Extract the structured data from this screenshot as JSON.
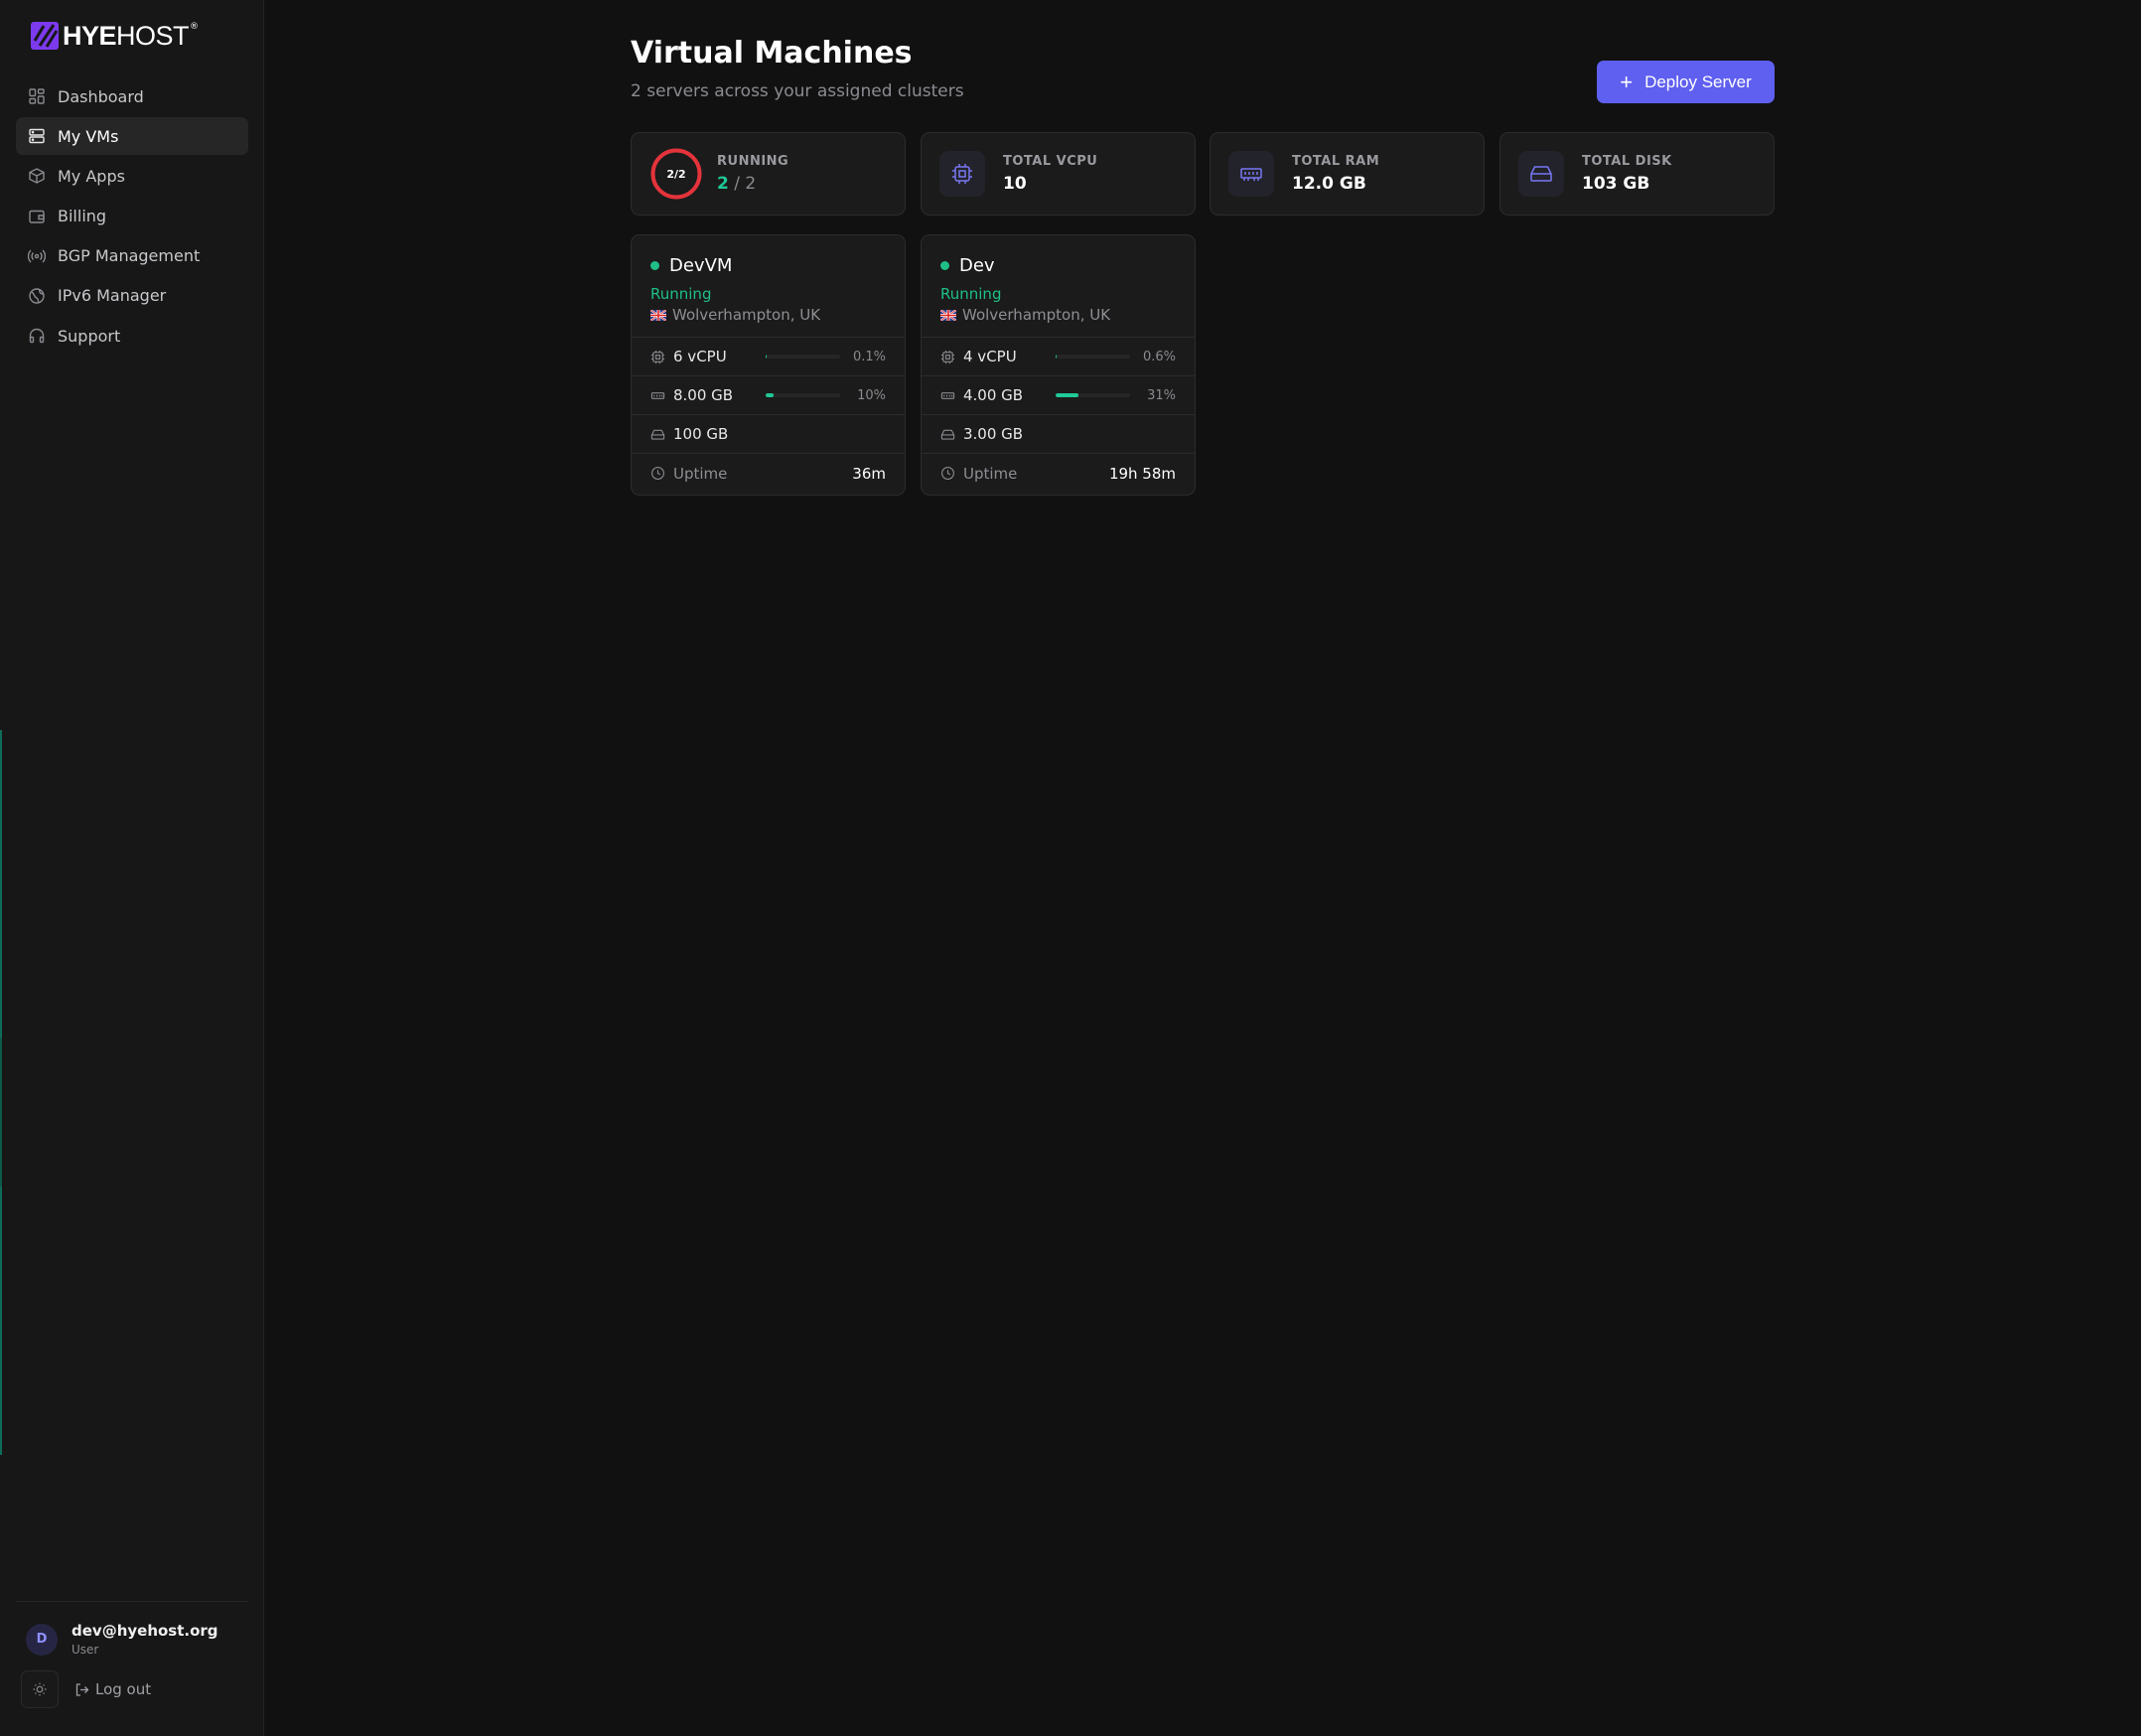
{
  "brand": {
    "name_bold": "HYE",
    "name_thin": "HOST",
    "reg": "®",
    "accent": "#7c3aed"
  },
  "nav": [
    {
      "label": "Dashboard",
      "icon": "grid-icon",
      "active": false
    },
    {
      "label": "My VMs",
      "icon": "server-icon",
      "active": true
    },
    {
      "label": "My Apps",
      "icon": "package-icon",
      "active": false
    },
    {
      "label": "Billing",
      "icon": "wallet-icon",
      "active": false
    },
    {
      "label": "BGP Management",
      "icon": "radio-icon",
      "active": false
    },
    {
      "label": "IPv6 Manager",
      "icon": "globe-icon",
      "active": false
    },
    {
      "label": "Support",
      "icon": "headphones-icon",
      "active": false
    }
  ],
  "user": {
    "initial": "D",
    "email": "dev@hyehost.org",
    "role": "User",
    "logout_label": "Log out"
  },
  "header": {
    "title": "Virtual Machines",
    "subtitle": "2 servers across your assigned clusters",
    "deploy_label": "Deploy Server"
  },
  "stats": {
    "running": {
      "ring_label": "2/2",
      "label": "Running",
      "running": "2",
      "sep": " / ",
      "total": "2",
      "fraction": 1.0
    },
    "vcpu": {
      "label": "Total vCPU",
      "value": "10"
    },
    "ram": {
      "label": "Total RAM",
      "value": "12.0 GB"
    },
    "disk": {
      "label": "Total Disk",
      "value": "103 GB"
    }
  },
  "vms": [
    {
      "name": "DevVM",
      "status": "Running",
      "location": "Wolverhampton, UK",
      "cpu": "6 vCPU",
      "cpu_pct": "0.1%",
      "cpu_frac": 0.001,
      "ram": "8.00 GB",
      "ram_pct": "10%",
      "ram_frac": 0.1,
      "disk": "100 GB",
      "uptime_label": "Uptime",
      "uptime": "36m"
    },
    {
      "name": "Dev",
      "status": "Running",
      "location": "Wolverhampton, UK",
      "cpu": "4 vCPU",
      "cpu_pct": "0.6%",
      "cpu_frac": 0.006,
      "ram": "4.00 GB",
      "ram_pct": "31%",
      "ram_frac": 0.31,
      "disk": "3.00 GB",
      "uptime_label": "Uptime",
      "uptime": "19h 58m"
    }
  ],
  "colors": {
    "accent": "#5f5ff0",
    "success": "#20c997",
    "ring": "#e5333b"
  }
}
